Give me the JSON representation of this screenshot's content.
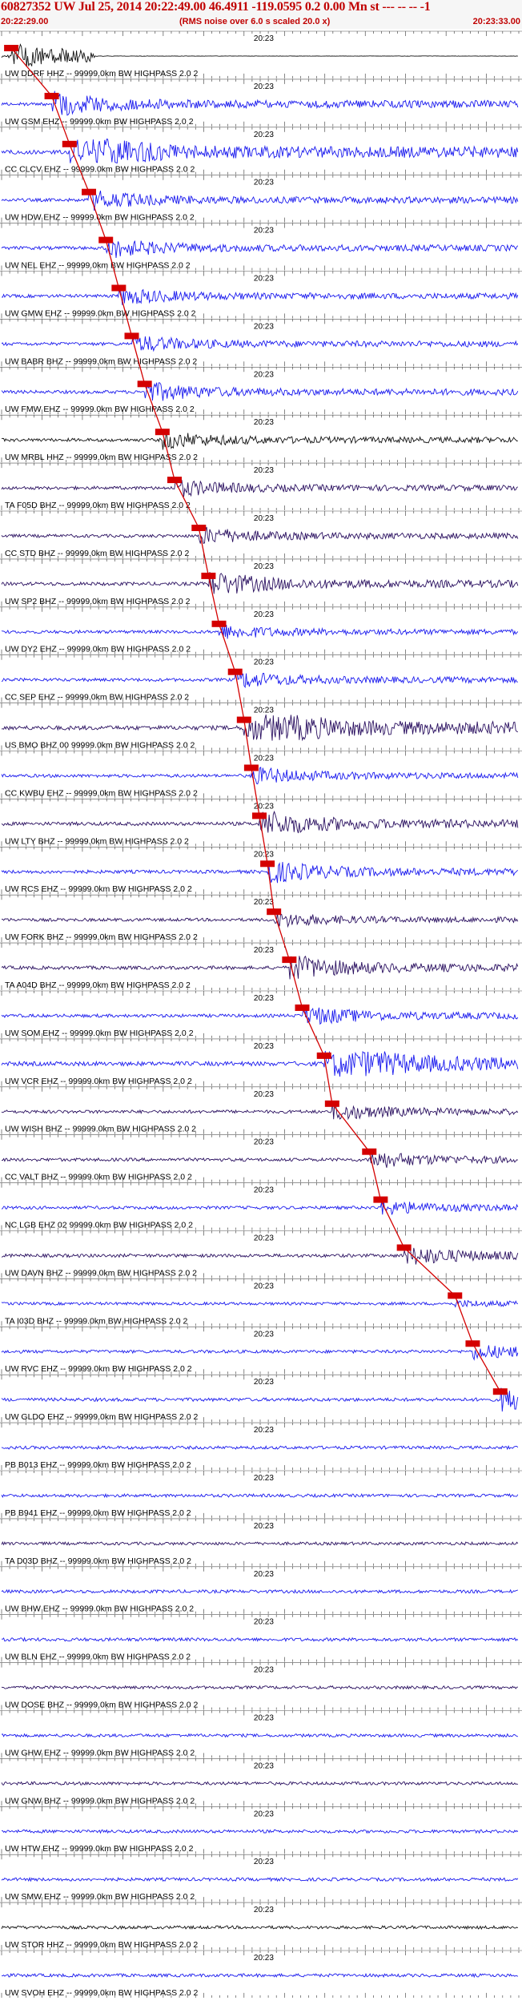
{
  "header": {
    "title": "60827352 UW Jul 25, 2014 20:22:49.00   46.4911 -119.0595  0.2 0.00 Mn st --- -- -- -1",
    "start_time": "20:22:29.00",
    "note": "(RMS noise over 6.0 s scaled 20.0 x)",
    "end_time": "20:23:33.00"
  },
  "chart_data": {
    "type": "seismogram-record-section",
    "time_start": "20:22:29.00",
    "time_end": "20:23:33.00",
    "minute_label": "20:23",
    "rms_note": "(RMS noise over 6.0 s scaled 20.0 x)",
    "pick_color": "#d40000",
    "colors": {
      "blue": "#1a1aee",
      "black": "#111111",
      "purple": "#2a1060"
    },
    "traces": [
      {
        "label": "UW DDRF HHZ -- 99999.0km BW  HIGHPASS  2.0  2",
        "color": "black",
        "amp": 0.45,
        "quiet_after": 0.18
      },
      {
        "label": "UW GSM EHZ -- 99999.0km BW  HIGHPASS  2.0  2",
        "color": "blue",
        "amp": 0.45
      },
      {
        "label": "CC CLCV EHZ -- 99999.0km BW  HIGHPASS  2.0  2",
        "color": "blue",
        "amp": 0.8
      },
      {
        "label": "UW HDW EHZ -- 99999.0km BW  HIGHPASS  2.0  2",
        "color": "blue",
        "amp": 0.35
      },
      {
        "label": "UW NEL EHZ -- 99999.0km BW  HIGHPASS  2.0  2",
        "color": "blue",
        "amp": 0.35
      },
      {
        "label": "UW GMW EHZ -- 99999.0km BW  HIGHPASS  2.0  2",
        "color": "blue",
        "amp": 0.3
      },
      {
        "label": "UW BABR BHZ -- 99999.0km BW  HIGHPASS  2.0  2",
        "color": "blue",
        "amp": 0.3
      },
      {
        "label": "UW FMW EHZ -- 99999.0km BW  HIGHPASS  2.0  2",
        "color": "blue",
        "amp": 0.35
      },
      {
        "label": "UW MRBL HHZ -- 99999.0km BW  HIGHPASS  2.0  2",
        "color": "black",
        "amp": 0.3
      },
      {
        "label": "TA F05D BHZ -- 99999.0km BW  HIGHPASS  2.0  2",
        "color": "purple",
        "amp": 0.3
      },
      {
        "label": "CC STD BHZ -- 99999.0km BW  HIGHPASS  2.0  2",
        "color": "purple",
        "amp": 0.3
      },
      {
        "label": "UW SP2 BHZ -- 99999.0km BW  HIGHPASS  2.0  2",
        "color": "purple",
        "amp": 0.45
      },
      {
        "label": "UW DY2 EHZ -- 99999.0km BW  HIGHPASS  2.0  2",
        "color": "blue",
        "amp": 0.25
      },
      {
        "label": "CC SEP EHZ -- 99999.0km BW  HIGHPASS  2.0  2",
        "color": "blue",
        "amp": 0.3
      },
      {
        "label": "US BMO BHZ 00 99999.0km BW  HIGHPASS  2.0  2",
        "color": "purple",
        "amp": 0.9
      },
      {
        "label": "CC KWBU EHZ -- 99999.0km BW  HIGHPASS  2.0  2",
        "color": "blue",
        "amp": 0.3
      },
      {
        "label": "UW LTY BHZ -- 99999.0km BW  HIGHPASS  2.0  2",
        "color": "purple",
        "amp": 0.5
      },
      {
        "label": "UW RCS EHZ -- 99999.0km BW  HIGHPASS  2.0  2",
        "color": "blue",
        "amp": 0.4
      },
      {
        "label": "UW FORK BHZ -- 99999.0km BW  HIGHPASS  2.0  2",
        "color": "purple",
        "amp": 0.25
      },
      {
        "label": "TA A04D BHZ -- 99999.0km BW  HIGHPASS  2.0  2",
        "color": "purple",
        "amp": 0.45
      },
      {
        "label": "UW SOM EHZ -- 99999.0km BW  HIGHPASS  2.0  2",
        "color": "blue",
        "amp": 0.35
      },
      {
        "label": "UW VCR EHZ -- 99999.0km BW  HIGHPASS  2.0  2",
        "color": "blue",
        "amp": 0.9
      },
      {
        "label": "UW WISH BHZ -- 99999.0km BW  HIGHPASS  2.0  2",
        "color": "purple",
        "amp": 0.3
      },
      {
        "label": "CC VALT BHZ -- 99999.0km BW  HIGHPASS  2.0  2",
        "color": "purple",
        "amp": 0.3
      },
      {
        "label": "NC LGB EHZ 02 99999.0km BW  HIGHPASS  2.0  2",
        "color": "blue",
        "amp": 0.25
      },
      {
        "label": "UW DAVN BHZ -- 99999.0km BW  HIGHPASS  2.0  2",
        "color": "purple",
        "amp": 0.35
      },
      {
        "label": "TA I03D BHZ -- 99999.0km BW  HIGHPASS  2.0  2",
        "color": "blue",
        "amp": 0.1
      },
      {
        "label": "UW RVC EHZ -- 99999.0km BW  HIGHPASS  2.0  2",
        "color": "blue",
        "amp": 0.25
      },
      {
        "label": "UW GLDO EHZ -- 99999.0km BW  HIGHPASS  2.0  2",
        "color": "blue",
        "amp": 0.4
      },
      {
        "label": "PB B013 EHZ -- 99999.0km BW  HIGHPASS  2.0  2",
        "color": "blue",
        "amp": 0.25
      },
      {
        "label": "PB B941 EHZ -- 99999.0km BW  HIGHPASS  2.0  2",
        "color": "blue",
        "amp": 0.25
      },
      {
        "label": "TA D03D BHZ -- 99999.0km BW  HIGHPASS  2.0  2",
        "color": "purple",
        "amp": 0.2
      },
      {
        "label": "UW BHW EHZ -- 99999.0km BW  HIGHPASS  2.0  2",
        "color": "blue",
        "amp": 0.3
      },
      {
        "label": "UW BLN EHZ -- 99999.0km BW  HIGHPASS  2.0  2",
        "color": "blue",
        "amp": 0.35
      },
      {
        "label": "UW DOSE BHZ -- 99999.0km BW  HIGHPASS  2.0  2",
        "color": "purple",
        "amp": 0.2
      },
      {
        "label": "UW GHW EHZ -- 99999.0km BW  HIGHPASS  2.0  2",
        "color": "blue",
        "amp": 0.25
      },
      {
        "label": "UW GNW BHZ -- 99999.0km BW  HIGHPASS  2.0  2",
        "color": "purple",
        "amp": 0.25
      },
      {
        "label": "UW HTW EHZ -- 99999.0km BW  HIGHPASS  2.0  2",
        "color": "blue",
        "amp": 0.25
      },
      {
        "label": "UW SMW EHZ -- 99999.0km BW  HIGHPASS  2.0  2",
        "color": "blue",
        "amp": 0.3
      },
      {
        "label": "UW STOR HHZ -- 99999.0km BW  HIGHPASS  2.0  2",
        "color": "black",
        "amp": 0.25
      },
      {
        "label": "UW SVOH EHZ -- 99999.0km BW  HIGHPASS  2.0  2",
        "color": "blue",
        "amp": 0.3
      }
    ],
    "picks": [
      {
        "trace": 0,
        "time_s": 1.2
      },
      {
        "trace": 1,
        "time_s": 6.2
      },
      {
        "trace": 2,
        "time_s": 8.4
      },
      {
        "trace": 3,
        "time_s": 10.8
      },
      {
        "trace": 4,
        "time_s": 12.9
      },
      {
        "trace": 5,
        "time_s": 14.5
      },
      {
        "trace": 6,
        "time_s": 16.1
      },
      {
        "trace": 7,
        "time_s": 17.7
      },
      {
        "trace": 8,
        "time_s": 19.9
      },
      {
        "trace": 9,
        "time_s": 21.4
      },
      {
        "trace": 10,
        "time_s": 24.4
      },
      {
        "trace": 11,
        "time_s": 25.6
      },
      {
        "trace": 12,
        "time_s": 26.9
      },
      {
        "trace": 13,
        "time_s": 28.9
      },
      {
        "trace": 14,
        "time_s": 30.0
      },
      {
        "trace": 15,
        "time_s": 30.9
      },
      {
        "trace": 16,
        "time_s": 31.9
      },
      {
        "trace": 17,
        "time_s": 32.9
      },
      {
        "trace": 18,
        "time_s": 33.7
      },
      {
        "trace": 19,
        "time_s": 35.6
      },
      {
        "trace": 20,
        "time_s": 37.2
      },
      {
        "trace": 21,
        "time_s": 39.9
      },
      {
        "trace": 22,
        "time_s": 40.9
      },
      {
        "trace": 23,
        "time_s": 45.5
      },
      {
        "trace": 24,
        "time_s": 46.9
      },
      {
        "trace": 25,
        "time_s": 49.8
      },
      {
        "trace": 26,
        "time_s": 56.1
      },
      {
        "trace": 27,
        "time_s": 58.3
      },
      {
        "trace": 28,
        "time_s": 61.7
      }
    ]
  }
}
